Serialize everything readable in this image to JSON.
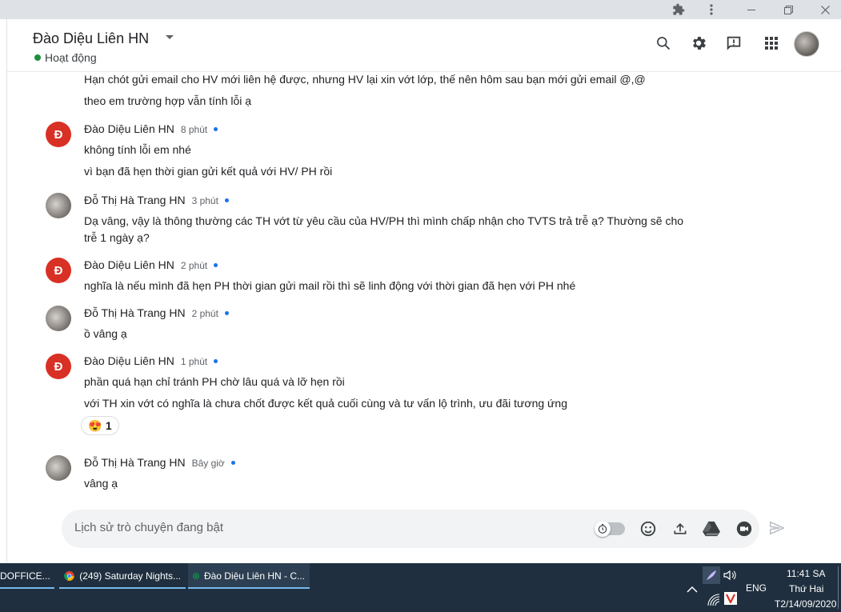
{
  "header": {
    "room_title": "Đào Diệu Liên HN",
    "presence_text": "Hoạt động"
  },
  "messages": {
    "prev_line1": "Hạn chót gửi email cho HV mới liên hệ được, nhưng HV lại xin vớt lớp, thế nên hôm sau bạn mới gửi email @,@",
    "prev_line2": "theo em trường hợp vẫn tính lỗi ạ",
    "m1": {
      "avatar": "Đ",
      "sender": "Đào Diệu Liên HN",
      "time": "8 phút",
      "line1": "không tính lỗi em nhé",
      "line2": "vì bạn đã hẹn thời gian gửi kết quả với HV/ PH rồi"
    },
    "m2": {
      "sender": "Đỗ Thị Hà Trang HN",
      "time": "3 phút",
      "line1": "Dạ vâng, vậy là thông thường các TH vớt từ yêu cầu của HV/PH thì mình chấp nhận cho TVTS trả trễ ạ? Thường sẽ cho",
      "line2": "trễ 1 ngày ạ?"
    },
    "m3": {
      "avatar": "Đ",
      "sender": "Đào Diệu Liên HN",
      "time": "2 phút",
      "line1": "nghĩa là nếu mình đã hẹn PH thời gian gửi mail rồi thì sẽ linh động với thời gian đã hẹn với PH nhé"
    },
    "m4": {
      "sender": "Đỗ Thị Hà Trang HN",
      "time": "2 phút",
      "line1": "ồ vâng ạ"
    },
    "m5": {
      "avatar": "Đ",
      "sender": "Đào Diệu Liên HN",
      "time": "1 phút",
      "line1": "phần quá hạn chỉ tránh PH chờ lâu quá và lỡ hẹn rồi",
      "line2": "với TH xin vớt có nghĩa là chưa chốt được kết quả cuối cùng và tư vấn lộ trình, ưu đãi tương ứng",
      "reaction_emoji": "😍",
      "reaction_count": "1"
    },
    "m6": {
      "sender": "Đỗ Thị Hà Trang HN",
      "time": "Bây giờ",
      "line1": "vâng ạ"
    }
  },
  "composer": {
    "placeholder": "Lịch sử trò chuyện đang bật"
  },
  "taskbar": {
    "task1": "DOFFICE...",
    "task2": "(249) Saturday Nights...",
    "task3": "Đào Diệu Liên HN - C...",
    "lang": "ENG",
    "time": "11:41 SA",
    "day": "Thứ Hai",
    "date": "T2/14/09/2020"
  },
  "colors": {
    "accent": "#1a73e8",
    "avatar_red": "#d93025",
    "presence_green": "#1e8e3e",
    "taskbar": "#1f2f3f"
  }
}
